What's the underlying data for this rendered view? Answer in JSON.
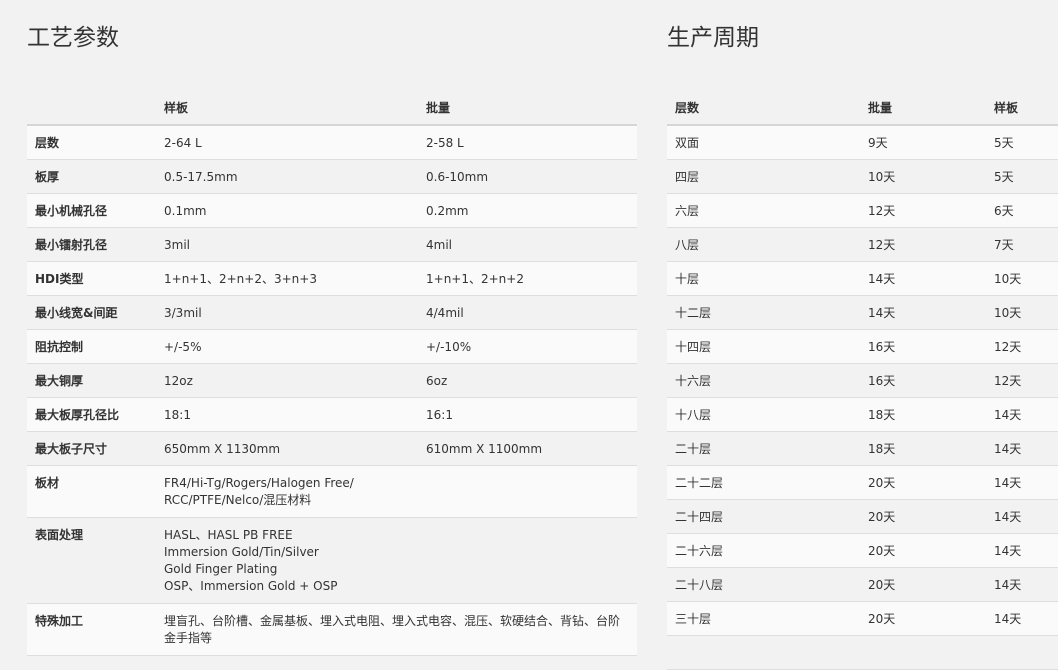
{
  "process_params": {
    "title": "工艺参数",
    "headers": [
      "",
      "样板",
      "批量"
    ],
    "rows": [
      {
        "label": "层数",
        "sample": [
          "2-64 L"
        ],
        "batch": [
          "2-58 L"
        ]
      },
      {
        "label": "板厚",
        "sample": [
          "0.5-17.5mm"
        ],
        "batch": [
          "0.6-10mm"
        ]
      },
      {
        "label": "最小机械孔径",
        "sample": [
          "0.1mm"
        ],
        "batch": [
          "0.2mm"
        ]
      },
      {
        "label": "最小镭射孔径",
        "sample": [
          "3mil"
        ],
        "batch": [
          "4mil"
        ]
      },
      {
        "label": "HDI类型",
        "sample": [
          "1+n+1、2+n+2、3+n+3"
        ],
        "batch": [
          "1+n+1、2+n+2"
        ]
      },
      {
        "label": "最小线宽&间距",
        "sample": [
          "3/3mil"
        ],
        "batch": [
          "4/4mil"
        ]
      },
      {
        "label": "阻抗控制",
        "sample": [
          "+/-5%"
        ],
        "batch": [
          "+/-10%"
        ]
      },
      {
        "label": "最大铜厚",
        "sample": [
          "12oz"
        ],
        "batch": [
          "6oz"
        ]
      },
      {
        "label": "最大板厚孔径比",
        "sample": [
          "18:1"
        ],
        "batch": [
          "16:1"
        ]
      },
      {
        "label": "最大板子尺寸",
        "sample": [
          "650mm X 1130mm"
        ],
        "batch": [
          "610mm X 1100mm"
        ]
      },
      {
        "label": "板材",
        "sample": [
          "FR4/Hi-Tg/Rogers/Halogen Free/",
          "RCC/PTFE/Nelco/混压材料"
        ],
        "batch": []
      },
      {
        "label": "表面处理",
        "sample": [
          "HASL、HASL PB FREE",
          "Immersion Gold/Tin/Silver",
          "Gold Finger Plating",
          "OSP、Immersion Gold + OSP"
        ],
        "batch": []
      },
      {
        "label": "特殊加工",
        "sample": [
          "埋盲孔、台阶槽、金属基板、埋入式电阻、埋入式电容、混压、软硬结合、背钻、台阶",
          "金手指等"
        ],
        "batch": []
      }
    ]
  },
  "production_cycle": {
    "title": "生产周期",
    "headers": [
      "层数",
      "批量",
      "样板"
    ],
    "rows": [
      [
        "双面",
        "9天",
        "5天"
      ],
      [
        "四层",
        "10天",
        "5天"
      ],
      [
        "六层",
        "12天",
        "6天"
      ],
      [
        "八层",
        "12天",
        "7天"
      ],
      [
        "十层",
        "14天",
        "10天"
      ],
      [
        "十二层",
        "14天",
        "10天"
      ],
      [
        "十四层",
        "16天",
        "12天"
      ],
      [
        "十六层",
        "16天",
        "12天"
      ],
      [
        "十八层",
        "18天",
        "14天"
      ],
      [
        "二十层",
        "18天",
        "14天"
      ],
      [
        "二十二层",
        "20天",
        "14天"
      ],
      [
        "二十四层",
        "20天",
        "14天"
      ],
      [
        "二十六层",
        "20天",
        "14天"
      ],
      [
        "二十八层",
        "20天",
        "14天"
      ],
      [
        "三十层",
        "20天",
        "14天"
      ],
      [
        "",
        "",
        ""
      ]
    ]
  }
}
